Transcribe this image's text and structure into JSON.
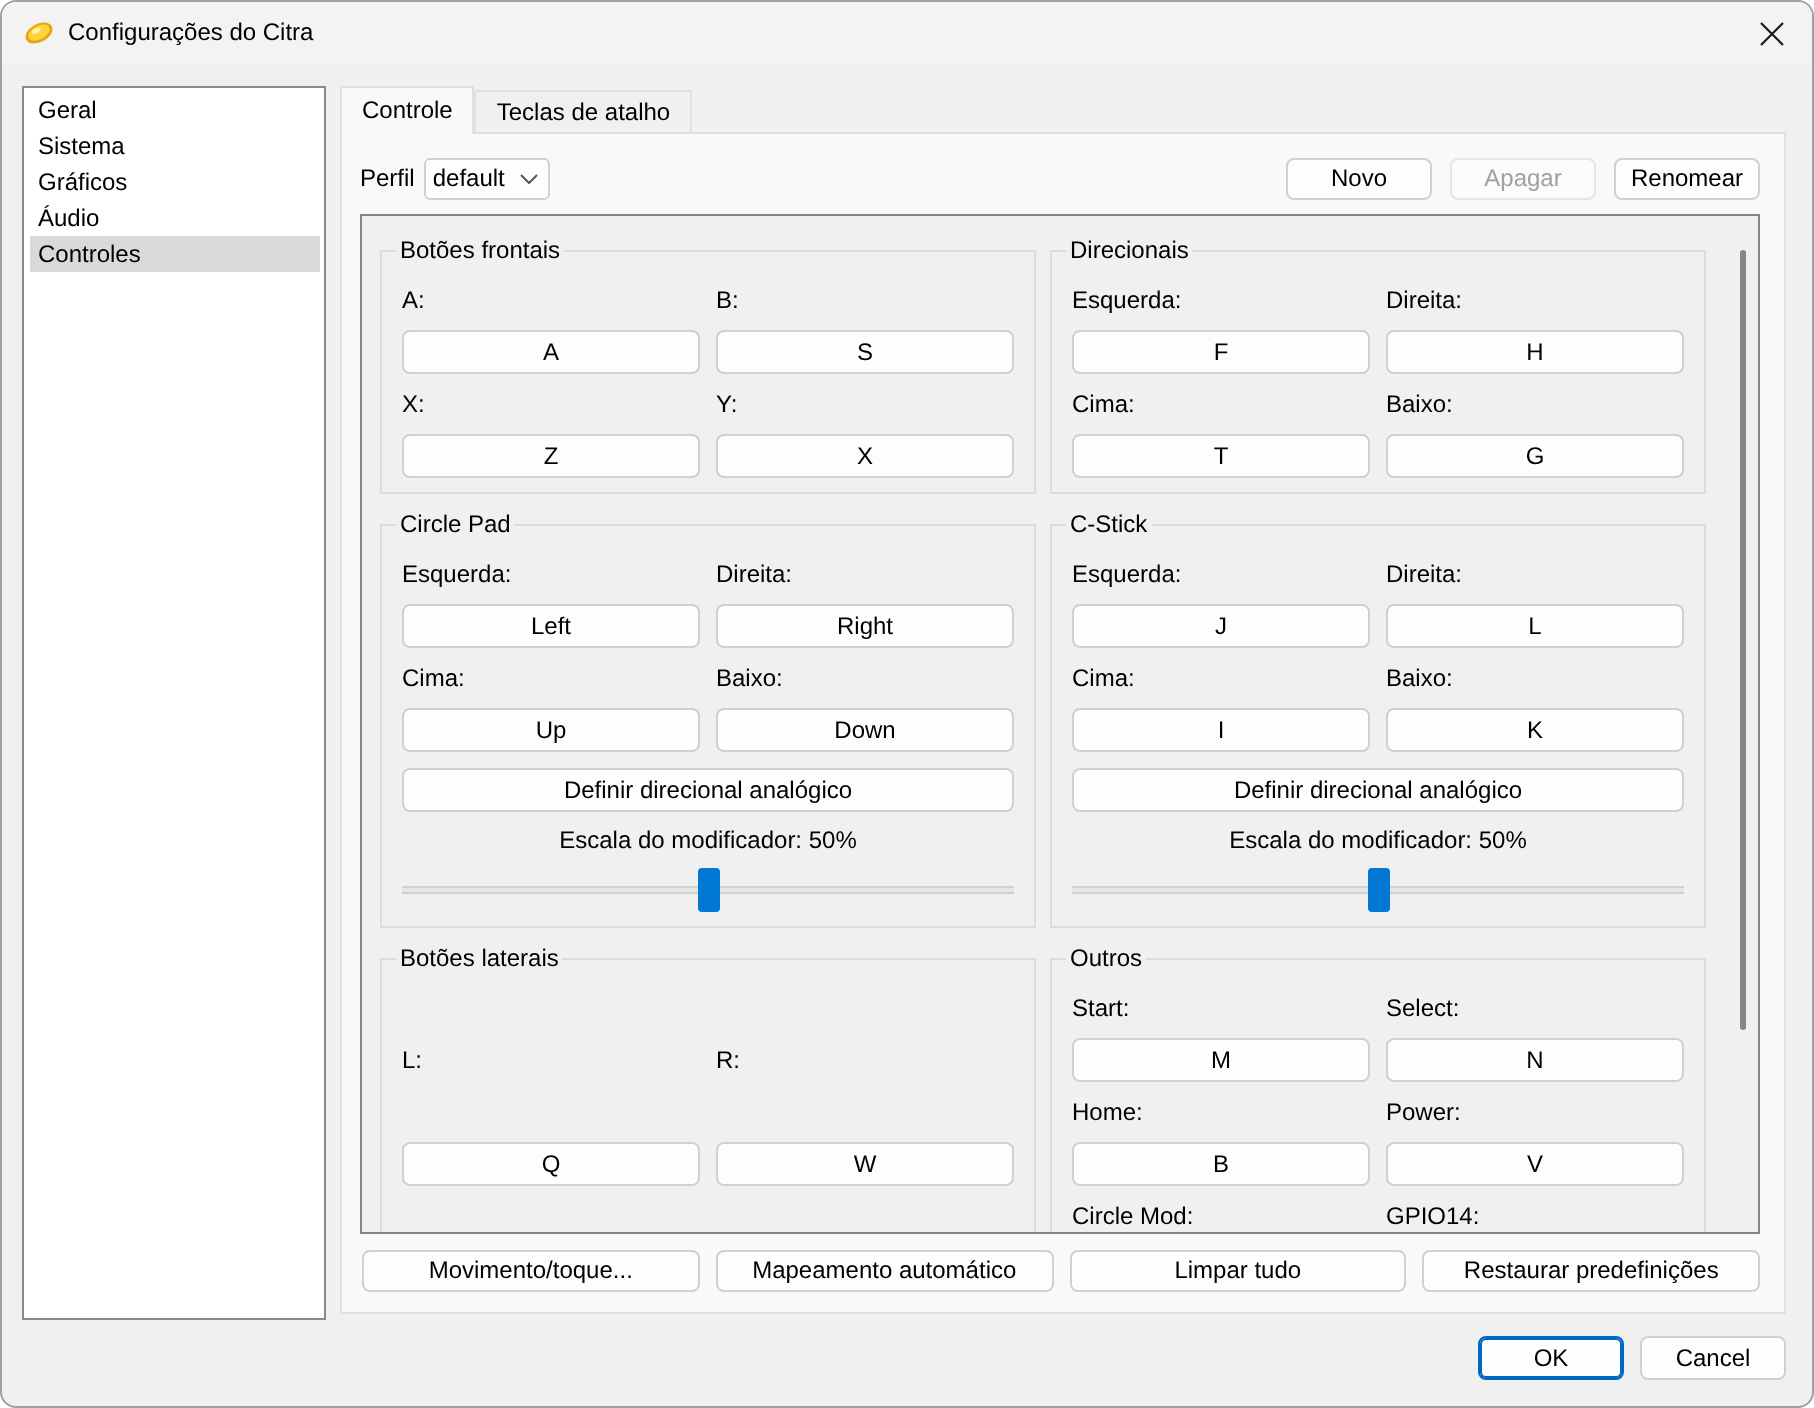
{
  "window": {
    "title": "Configurações do Citra"
  },
  "sidebar": {
    "items": [
      {
        "label": "Geral",
        "selected": false
      },
      {
        "label": "Sistema",
        "selected": false
      },
      {
        "label": "Gráficos",
        "selected": false
      },
      {
        "label": "Áudio",
        "selected": false
      },
      {
        "label": "Controles",
        "selected": true
      }
    ]
  },
  "tabs": [
    {
      "label": "Controle",
      "selected": true
    },
    {
      "label": "Teclas de atalho",
      "selected": false
    }
  ],
  "profile": {
    "label": "Perfil",
    "value": "default"
  },
  "profile_buttons": [
    {
      "label": "Novo",
      "disabled": false
    },
    {
      "label": "Apagar",
      "disabled": true
    },
    {
      "label": "Renomear",
      "disabled": false
    }
  ],
  "group_rows": [
    [
      {
        "title": "Botões frontais",
        "bindings": [
          {
            "label": "A:",
            "key": "A"
          },
          {
            "label": "B:",
            "key": "S"
          },
          {
            "label": "X:",
            "key": "Z"
          },
          {
            "label": "Y:",
            "key": "X"
          }
        ]
      },
      {
        "title": "Direcionais",
        "bindings": [
          {
            "label": "Esquerda:",
            "key": "F"
          },
          {
            "label": "Direita:",
            "key": "H"
          },
          {
            "label": "Cima:",
            "key": "T"
          },
          {
            "label": "Baixo:",
            "key": "G"
          }
        ]
      }
    ],
    [
      {
        "title": "Circle Pad",
        "bindings": [
          {
            "label": "Esquerda:",
            "key": "Left"
          },
          {
            "label": "Direita:",
            "key": "Right"
          },
          {
            "label": "Cima:",
            "key": "Up"
          },
          {
            "label": "Baixo:",
            "key": "Down"
          }
        ],
        "analog_button": "Definir direcional analógico",
        "modifier": {
          "label": "Escala do modificador: 50%",
          "level": 0.5
        }
      },
      {
        "title": "C-Stick",
        "bindings": [
          {
            "label": "Esquerda:",
            "key": "J"
          },
          {
            "label": "Direita:",
            "key": "L"
          },
          {
            "label": "Cima:",
            "key": "I"
          },
          {
            "label": "Baixo:",
            "key": "K"
          }
        ],
        "analog_button": "Definir direcional analógico",
        "modifier": {
          "label": "Escala do modificador: 50%",
          "level": 0.5
        }
      }
    ],
    [
      {
        "title": "Botões laterais",
        "bindings": [
          {
            "label": "L:",
            "key": "Q"
          },
          {
            "label": "R:",
            "key": "W"
          }
        ]
      },
      {
        "title": "Outros",
        "bindings": [
          {
            "label": "Start:",
            "key": "M"
          },
          {
            "label": "Select:",
            "key": "N"
          },
          {
            "label": "Home:",
            "key": "B"
          },
          {
            "label": "Power:",
            "key": "V"
          },
          {
            "label": "Circle Mod:"
          },
          {
            "label": "GPIO14:"
          }
        ]
      }
    ]
  ],
  "action_buttons": [
    "Movimento/toque...",
    "Mapeamento automático",
    "Limpar tudo",
    "Restaurar predefinições"
  ],
  "dialog_buttons": [
    {
      "label": "OK",
      "default": true
    },
    {
      "label": "Cancel",
      "default": false
    }
  ]
}
